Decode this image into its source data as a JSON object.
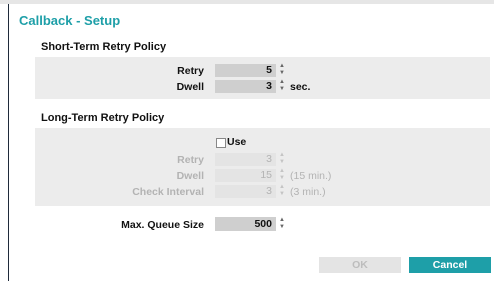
{
  "dialog": {
    "title": "Callback - Setup"
  },
  "short_term": {
    "heading": "Short-Term Retry Policy",
    "retry": {
      "label": "Retry",
      "value": "5"
    },
    "dwell": {
      "label": "Dwell",
      "value": "3",
      "unit": "sec."
    }
  },
  "long_term": {
    "heading": "Long-Term Retry Policy",
    "use": {
      "label": "Use",
      "checked": false
    },
    "retry": {
      "label": "Retry",
      "value": "3"
    },
    "dwell": {
      "label": "Dwell",
      "value": "15",
      "unit": "(15 min.)"
    },
    "check_interval": {
      "label": "Check Interval",
      "value": "3",
      "unit": "(3 min.)"
    }
  },
  "queue": {
    "label": "Max. Queue Size",
    "value": "500"
  },
  "buttons": {
    "ok": "OK",
    "cancel": "Cancel"
  },
  "colors": {
    "accent": "#1e9fa8",
    "panel": "#ececec",
    "disabled_text": "#b3b3b3"
  }
}
